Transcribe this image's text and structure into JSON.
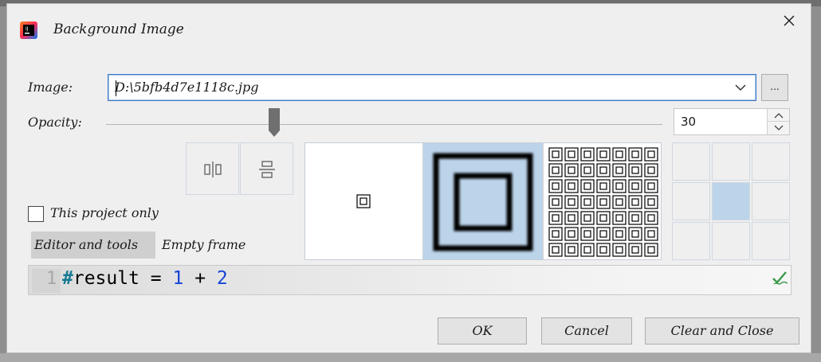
{
  "dialog": {
    "title": "Background Image",
    "app_icon": "intellij-idea-icon",
    "close_icon": "close-icon"
  },
  "image_field": {
    "label": "Image:",
    "value": "D:\\5bfb4d7e1118c.jpg",
    "browse_label": "..."
  },
  "opacity": {
    "label": "Opacity:",
    "value": "30",
    "slider_level_percent": 30
  },
  "options": {
    "this_project_only_label": "This project only",
    "this_project_only_checked": false
  },
  "alignment": {
    "fill_options": [
      "plain",
      "scale",
      "tile"
    ],
    "selected_fill": "scale",
    "anchor_selected": "center"
  },
  "tabs": {
    "items": [
      "Editor and tools",
      "Empty frame"
    ],
    "active": "Editor and tools"
  },
  "preview": {
    "line_number": "1",
    "tokens": [
      "#",
      "result",
      " = ",
      "1",
      " + ",
      "2"
    ]
  },
  "buttons": {
    "ok": "OK",
    "cancel": "Cancel",
    "clear_and_close": "Clear and Close"
  },
  "colors": {
    "accent": "#3b78c9",
    "selection": "#bcd4ea",
    "dialog_bg": "#efefef",
    "number_token": "#1744d6",
    "hash_token": "#157a93"
  }
}
